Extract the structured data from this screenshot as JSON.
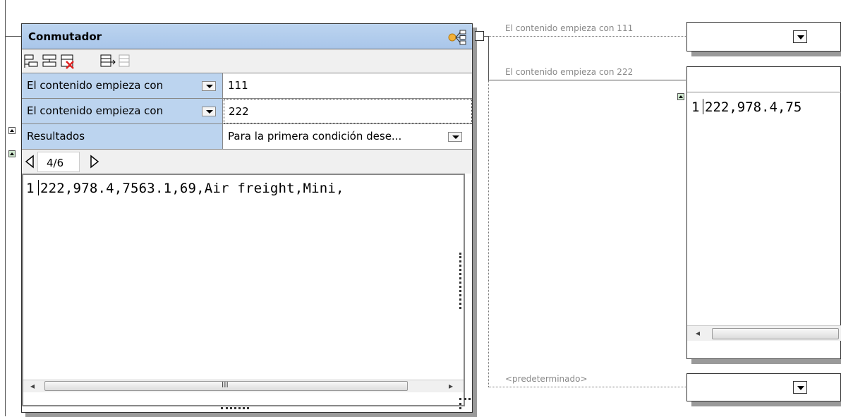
{
  "switch_component": {
    "title": "Conmutador",
    "conditions": [
      {
        "label": "El contenido empieza con",
        "value": "111"
      },
      {
        "label": "El contenido empieza con",
        "value": "222"
      }
    ],
    "results_label": "Resultados",
    "results_value": "Para la primera condición dese...",
    "pager": "4/6",
    "line_number": "1",
    "editor_text": "222,978.4,7563.1,69,Air freight,Mini,"
  },
  "outputs": {
    "cond1_label": "El contenido empieza con 111",
    "cond2_label": "El contenido empieza con 222",
    "default_label": "<predeterminado>",
    "preview_line_number": "1",
    "preview_text": "222,978.4,75"
  },
  "colors": {
    "header_blue": "#bcd4ef",
    "border": "#333333",
    "label_gray": "#888888"
  }
}
